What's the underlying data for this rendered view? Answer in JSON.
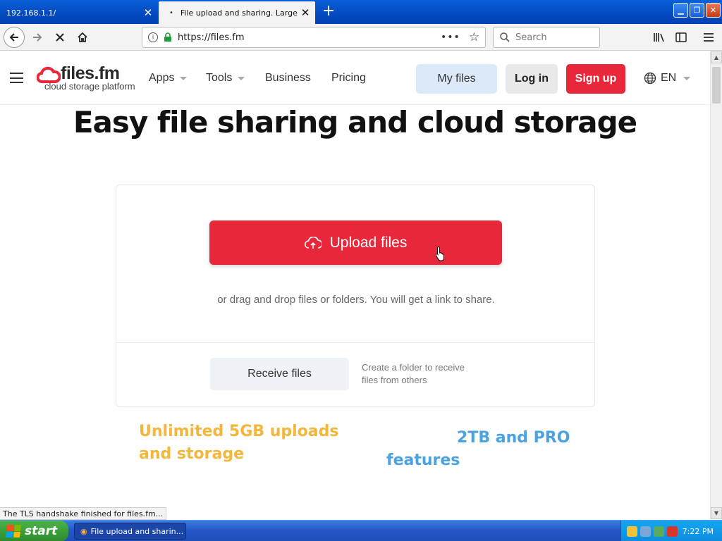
{
  "browser": {
    "tabs": [
      {
        "title": "192.168.1.1/",
        "active": false
      },
      {
        "title": "File upload and sharing. Large file t",
        "active": true
      }
    ],
    "url": "https://files.fm",
    "search_placeholder": "Search",
    "status_text": "The TLS handshake finished for files.fm..."
  },
  "site": {
    "logo_text": "files.fm",
    "logo_tagline": "cloud storage platform",
    "menu": {
      "apps": "Apps",
      "tools": "Tools",
      "business": "Business",
      "pricing": "Pricing"
    },
    "buttons": {
      "my_files": "My files",
      "login": "Log in",
      "signup": "Sign up"
    },
    "language": "EN"
  },
  "hero": {
    "title": "Easy file sharing and cloud storage",
    "upload_label": "Upload files",
    "drag_text": "or drag and drop files or folders. You will get a link to share.",
    "receive_label": "Receive files",
    "receive_desc": "Create a folder to receive files from others"
  },
  "features": {
    "feature1": "Unlimited 5GB uploads and storage",
    "feature2": "2TB and PRO features"
  },
  "taskbar": {
    "start_label": "start",
    "task_title": "File upload and sharin...",
    "clock": "7:22 PM"
  },
  "colors": {
    "accent_red": "#e8283a",
    "feature_yellow": "#f4b63b",
    "feature_blue": "#4ba2e0",
    "my_files_bg": "#dbe9f9"
  }
}
